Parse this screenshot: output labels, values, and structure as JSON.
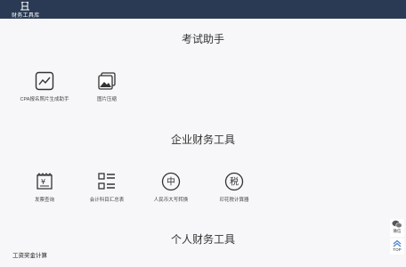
{
  "site": {
    "logo_text": "财务工具库"
  },
  "sections": [
    {
      "title": "考试助手",
      "tools": [
        {
          "label": "CPA报名照片生成助手",
          "icon": "chart-picture-icon"
        },
        {
          "label": "图片压缩",
          "icon": "image-stack-icon"
        }
      ]
    },
    {
      "title": "企业财务工具",
      "tools": [
        {
          "label": "发票查询",
          "icon": "invoice-icon",
          "glyph": "¥"
        },
        {
          "label": "会计科目汇总表",
          "icon": "list-icon"
        },
        {
          "label": "人民币大写转换",
          "icon": "chinese-character-circle-icon",
          "glyph": "中"
        },
        {
          "label": "印花税计算器",
          "icon": "tax-circle-icon",
          "glyph": "税"
        }
      ]
    },
    {
      "title": "个人财务工具",
      "tools": []
    }
  ],
  "personal_list": {
    "first_item": "工资奖金计算"
  },
  "float_buttons": {
    "wechat_label": "微信",
    "top_label": "TOP"
  },
  "colors": {
    "header": "#2a3a54",
    "background": "#f7f7f9",
    "icon": "#333333"
  }
}
